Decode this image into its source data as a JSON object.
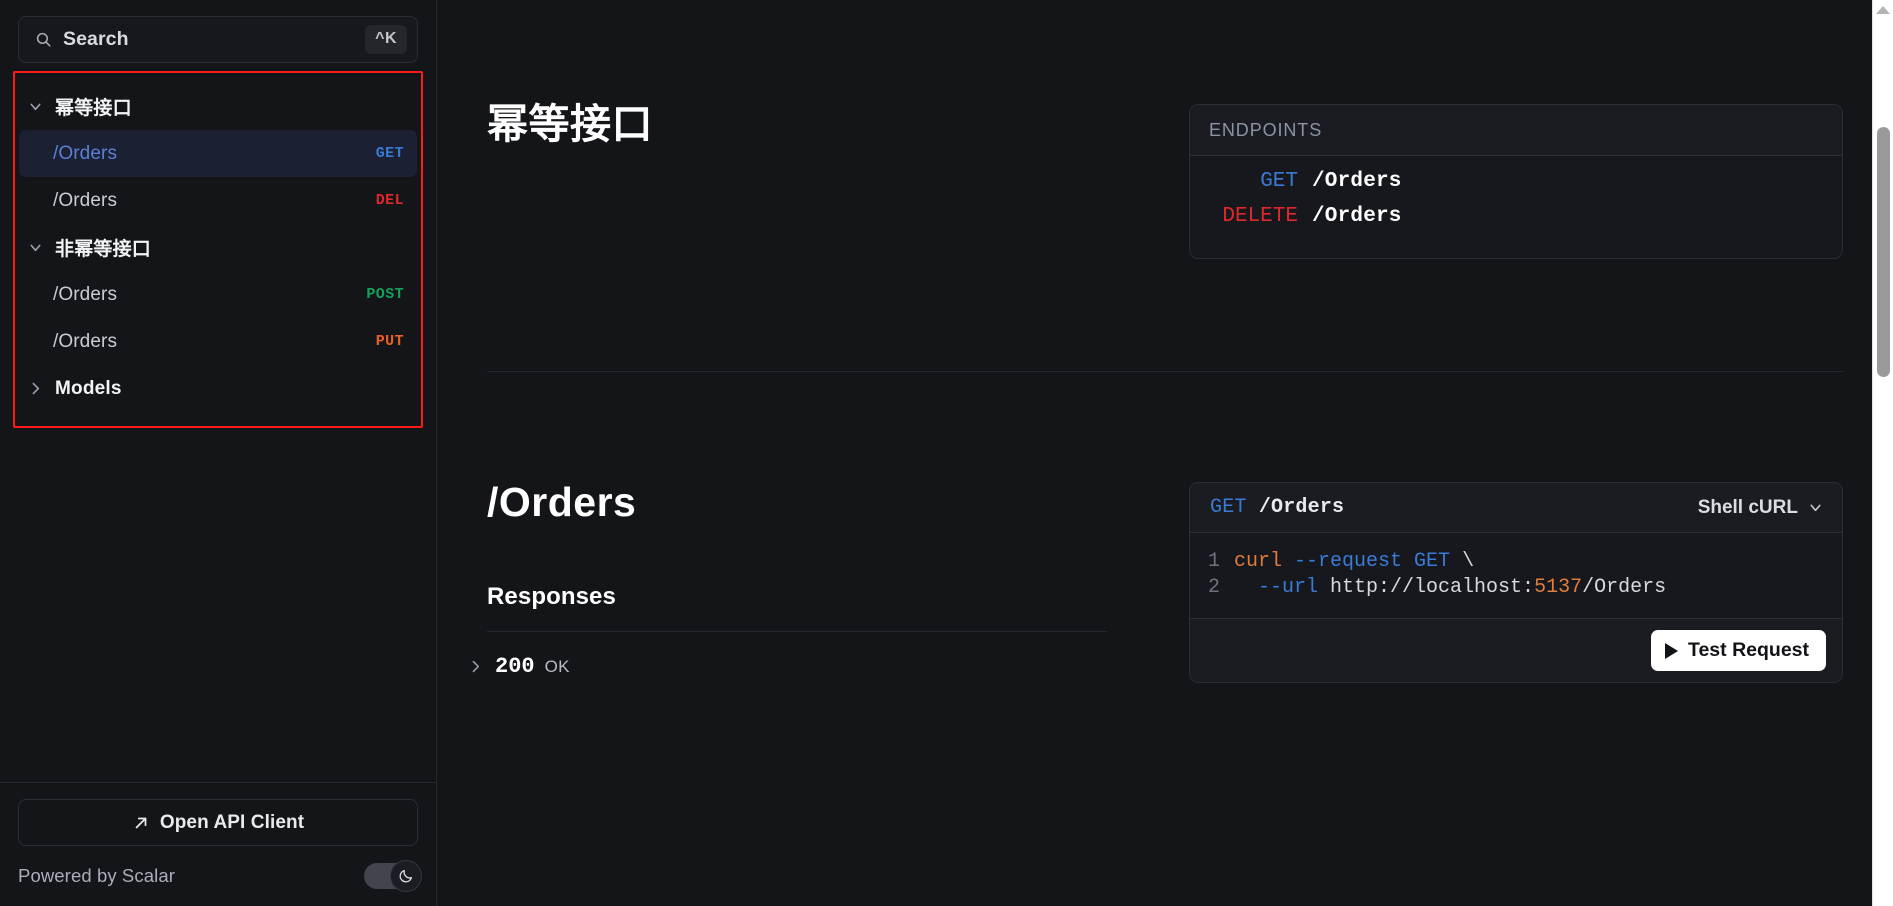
{
  "sidebar": {
    "search": {
      "placeholder": "Search",
      "shortcut": "^K",
      "icon": "search-icon"
    },
    "groups": [
      {
        "label": "幂等接口",
        "expanded": true,
        "chevron": "chevron-down-icon",
        "items": [
          {
            "path": "/Orders",
            "method": "GET",
            "method_color": "#3a7bd5",
            "active": true
          },
          {
            "path": "/Orders",
            "method": "DEL",
            "method_color": "#e0272c",
            "active": false
          }
        ]
      },
      {
        "label": "非幂等接口",
        "expanded": true,
        "chevron": "chevron-down-icon",
        "items": [
          {
            "path": "/Orders",
            "method": "POST",
            "method_color": "#15a05b",
            "active": false
          },
          {
            "path": "/Orders",
            "method": "PUT",
            "method_color": "#eb6022",
            "active": false
          }
        ]
      }
    ],
    "models": {
      "label": "Models",
      "expanded": false,
      "chevron": "chevron-right-icon"
    },
    "footer": {
      "open_client_label": "Open API Client",
      "open_client_icon": "arrow-up-right-icon",
      "powered_by": "Powered by Scalar",
      "theme_toggle_icon": "moon-icon",
      "theme_toggle_on": true
    }
  },
  "main": {
    "tag_section": {
      "title": "幂等接口",
      "endpoints_card": {
        "heading": "ENDPOINTS",
        "rows": [
          {
            "method": "GET",
            "method_color": "#3a7bd5",
            "path": "/Orders"
          },
          {
            "method": "DELETE",
            "method_color": "#e0272c",
            "path": "/Orders"
          }
        ]
      }
    },
    "operation_section": {
      "title": "/Orders",
      "responses_heading": "Responses",
      "responses": [
        {
          "code": "200",
          "text": "OK",
          "chevron": "chevron-right-icon",
          "expanded": false
        }
      ],
      "code_panel": {
        "method": "GET",
        "method_color": "#3a7bd5",
        "path": "/Orders",
        "language_label": "Shell cURL",
        "language_chevron": "chevron-down-icon",
        "lines": [
          {
            "number": "1",
            "tokens": [
              {
                "text": "curl ",
                "type": "cmd"
              },
              {
                "text": "--request ",
                "type": "flag"
              },
              {
                "text": "GET ",
                "type": "flag"
              },
              {
                "text": "\\",
                "type": "plain"
              }
            ]
          },
          {
            "number": "2",
            "tokens": [
              {
                "text": "  --url ",
                "type": "flag"
              },
              {
                "text": "http://localhost:",
                "type": "plain"
              },
              {
                "text": "5137",
                "type": "num"
              },
              {
                "text": "/Orders",
                "type": "plain"
              }
            ]
          }
        ],
        "test_button_label": "Test Request",
        "test_button_icon": "play-icon"
      }
    }
  },
  "colors": {
    "background": "#131519",
    "panel": "#16181d",
    "border": "#2b2e35",
    "highlight_box": "#ff1a1a",
    "active_row": "#1b2133"
  }
}
